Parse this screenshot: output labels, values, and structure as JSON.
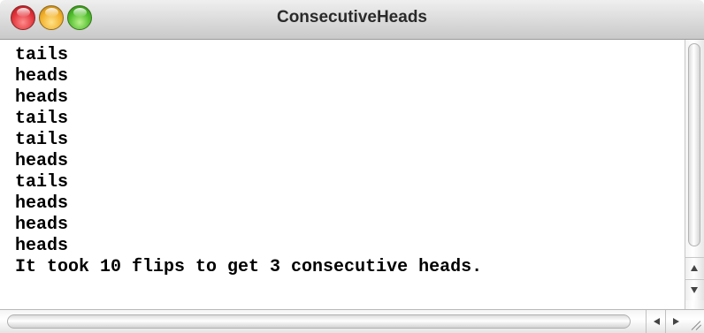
{
  "window": {
    "title": "ConsecutiveHeads"
  },
  "console": {
    "lines": [
      "tails",
      "heads",
      "heads",
      "tails",
      "tails",
      "heads",
      "tails",
      "heads",
      "heads",
      "heads",
      "It took 10 flips to get 3 consecutive heads."
    ]
  },
  "icons": {
    "close": "close-button-icon",
    "minimize": "minimize-button-icon",
    "zoom": "zoom-button-icon",
    "scroll_up": "arrow-up-icon",
    "scroll_down": "arrow-down-icon",
    "scroll_left": "arrow-left-icon",
    "scroll_right": "arrow-right-icon",
    "resize": "resize-grip-icon"
  },
  "colors": {
    "close": "#e0343a",
    "minimize": "#f2b02a",
    "zoom": "#4fbd2b",
    "text": "#000000",
    "background": "#ffffff"
  }
}
